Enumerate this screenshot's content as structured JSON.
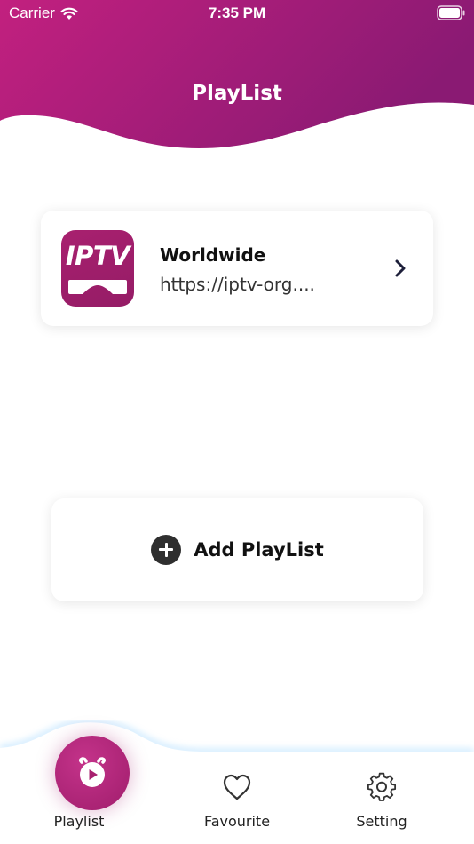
{
  "status_bar": {
    "carrier": "Carrier",
    "time": "7:35 PM"
  },
  "header": {
    "title": "PlayList",
    "gradient": [
      "#c2207f",
      "#8a1a73"
    ]
  },
  "playlists": [
    {
      "logo_text": "IPTV",
      "name": "Worldwide",
      "url": "https://iptv-org...."
    }
  ],
  "add_playlist": {
    "label": "Add PlayList"
  },
  "tabbar": {
    "tabs": [
      {
        "label": "Playlist",
        "icon": "play-alarm-icon",
        "active": true
      },
      {
        "label": "Favourite",
        "icon": "heart-icon",
        "active": false
      },
      {
        "label": "Setting",
        "icon": "gear-icon",
        "active": false
      }
    ]
  },
  "colors": {
    "accent": "#a8206f",
    "text_dark": "#111111"
  }
}
